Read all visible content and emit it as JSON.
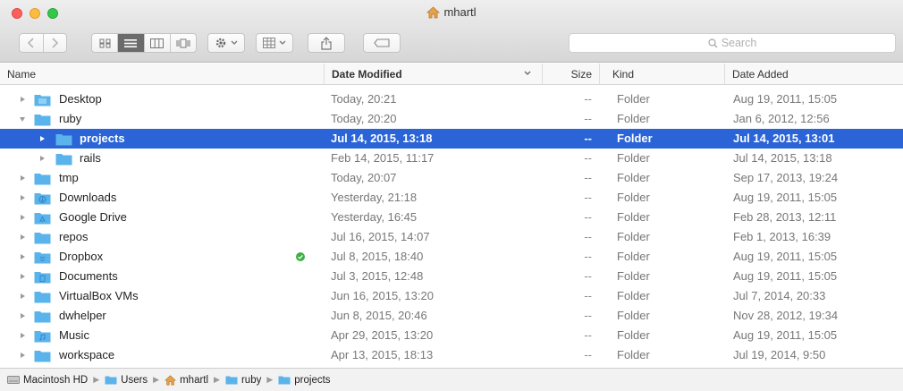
{
  "window": {
    "title": "mhartl"
  },
  "toolbar": {
    "search_placeholder": "Search"
  },
  "columns": {
    "name": "Name",
    "date_modified": "Date Modified",
    "size": "Size",
    "kind": "Kind",
    "date_added": "Date Added"
  },
  "rows": [
    {
      "name": "Desktop",
      "date_modified": "Today, 20:21",
      "size": "--",
      "kind": "Folder",
      "date_added": "Aug 19, 2011, 15:05"
    },
    {
      "name": "ruby",
      "date_modified": "Today, 20:20",
      "size": "--",
      "kind": "Folder",
      "date_added": "Jan 6, 2012, 12:56"
    },
    {
      "name": "projects",
      "date_modified": "Jul 14, 2015, 13:18",
      "size": "--",
      "kind": "Folder",
      "date_added": "Jul 14, 2015, 13:01"
    },
    {
      "name": "rails",
      "date_modified": "Feb 14, 2015, 11:17",
      "size": "--",
      "kind": "Folder",
      "date_added": "Jul 14, 2015, 13:18"
    },
    {
      "name": "tmp",
      "date_modified": "Today, 20:07",
      "size": "--",
      "kind": "Folder",
      "date_added": "Sep 17, 2013, 19:24"
    },
    {
      "name": "Downloads",
      "date_modified": "Yesterday, 21:18",
      "size": "--",
      "kind": "Folder",
      "date_added": "Aug 19, 2011, 15:05"
    },
    {
      "name": "Google Drive",
      "date_modified": "Yesterday, 16:45",
      "size": "--",
      "kind": "Folder",
      "date_added": "Feb 28, 2013, 12:11"
    },
    {
      "name": "repos",
      "date_modified": "Jul 16, 2015, 14:07",
      "size": "--",
      "kind": "Folder",
      "date_added": "Feb 1, 2013, 16:39"
    },
    {
      "name": "Dropbox",
      "date_modified": "Jul 8, 2015, 18:40",
      "size": "--",
      "kind": "Folder",
      "date_added": "Aug 19, 2011, 15:05"
    },
    {
      "name": "Documents",
      "date_modified": "Jul 3, 2015, 12:48",
      "size": "--",
      "kind": "Folder",
      "date_added": "Aug 19, 2011, 15:05"
    },
    {
      "name": "VirtualBox VMs",
      "date_modified": "Jun 16, 2015, 13:20",
      "size": "--",
      "kind": "Folder",
      "date_added": "Jul 7, 2014, 20:33"
    },
    {
      "name": "dwhelper",
      "date_modified": "Jun 8, 2015, 20:46",
      "size": "--",
      "kind": "Folder",
      "date_added": "Nov 28, 2012, 19:34"
    },
    {
      "name": "Music",
      "date_modified": "Apr 29, 2015, 13:20",
      "size": "--",
      "kind": "Folder",
      "date_added": "Aug 19, 2011, 15:05"
    },
    {
      "name": "workspace",
      "date_modified": "Apr 13, 2015, 18:13",
      "size": "--",
      "kind": "Folder",
      "date_added": "Jul 19, 2014, 9:50"
    }
  ],
  "pathbar": {
    "items": [
      "Macintosh HD",
      "Users",
      "mhartl",
      "ruby",
      "projects"
    ]
  },
  "colors": {
    "selection": "#2a64d6",
    "folder": "#5ab3ea",
    "ok_badge": "#3cb043"
  }
}
